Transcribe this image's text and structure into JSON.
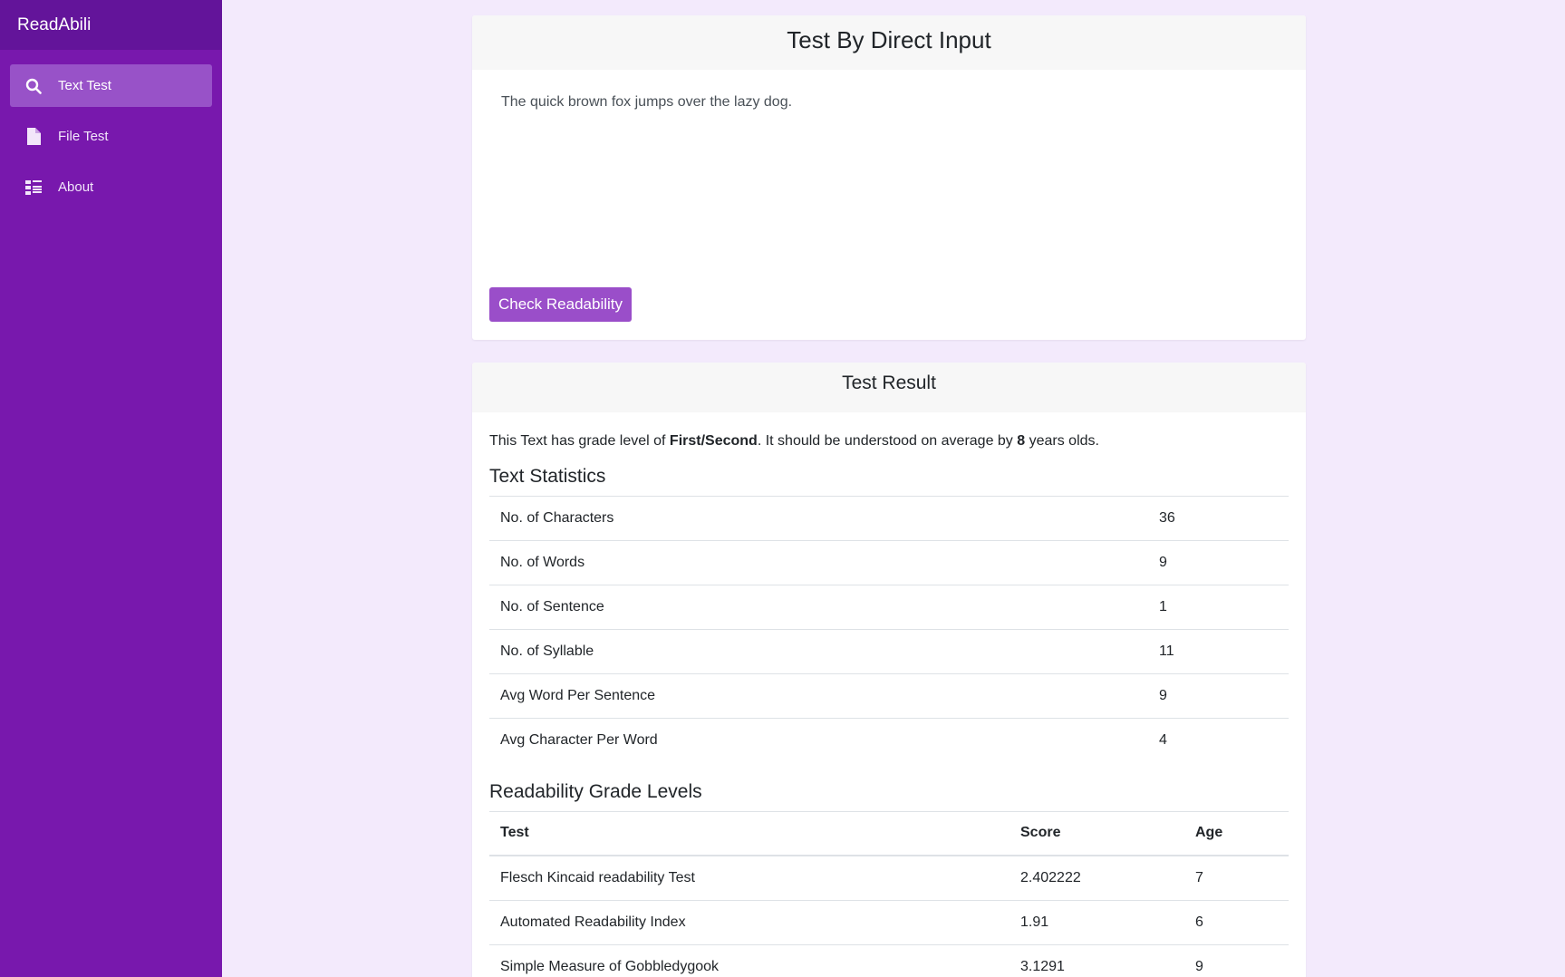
{
  "brand": "ReadAbili",
  "nav": [
    {
      "label": "Text Test",
      "icon": "search-icon",
      "active": true
    },
    {
      "label": "File Test",
      "icon": "file-icon",
      "active": false
    },
    {
      "label": "About",
      "icon": "list-icon",
      "active": false
    }
  ],
  "input_card": {
    "title": "Test By Direct Input",
    "text": "The quick brown fox jumps over the lazy dog.",
    "button": "Check Readability"
  },
  "result_card": {
    "title": "Test Result",
    "summary": {
      "prefix": "This Text has grade level of ",
      "grade": "First/Second",
      "middle": ". It should be understood on average by ",
      "age": "8",
      "suffix": " years olds."
    },
    "stats_title": "Text Statistics",
    "stats": [
      {
        "label": "No. of Characters",
        "value": "36"
      },
      {
        "label": "No. of Words",
        "value": "9"
      },
      {
        "label": "No. of Sentence",
        "value": "1"
      },
      {
        "label": "No. of Syllable",
        "value": "11"
      },
      {
        "label": "Avg Word Per Sentence",
        "value": "9"
      },
      {
        "label": "Avg Character Per Word",
        "value": "4"
      }
    ],
    "grades_title": "Readability Grade Levels",
    "grades_headers": {
      "test": "Test",
      "score": "Score",
      "age": "Age"
    },
    "grades": [
      {
        "test": "Flesch Kincaid readability Test",
        "score": "2.402222",
        "age": "7"
      },
      {
        "test": "Automated Readability Index",
        "score": "1.91",
        "age": "6"
      },
      {
        "test": "Simple Measure of Gobbledygook",
        "score": "3.1291",
        "age": "9"
      }
    ]
  },
  "colors": {
    "sidebar": "#7818ad",
    "brand_bar": "#63149a",
    "active_item": "#9852c8",
    "button": "#9a4ec9",
    "page_bg": "#f3eafc"
  }
}
